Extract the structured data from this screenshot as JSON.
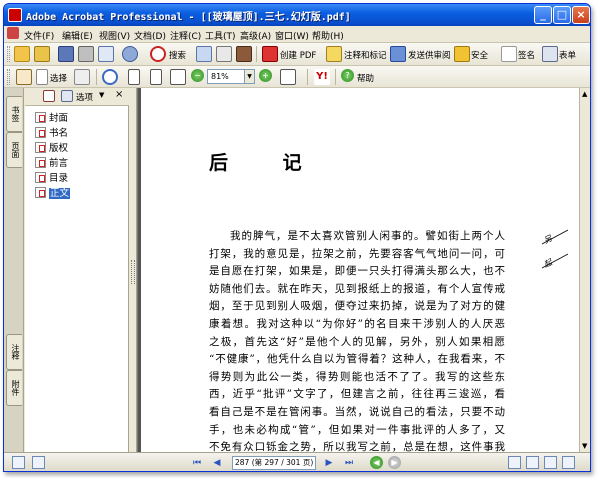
{
  "window": {
    "title": "Adobe Acrobat Professional - [[玻璃屋顶].三七.幻灯版.pdf]",
    "controls": {
      "minimize": "_",
      "maximize": "□",
      "close": "×"
    }
  },
  "menubar": {
    "items": [
      "文件(F)",
      "编辑(E)",
      "视图(V)",
      "文档(D)",
      "注释(C)",
      "工具(T)",
      "高级(A)",
      "窗口(W)",
      "帮助(H)"
    ]
  },
  "toolbar1": {
    "search_label": "搜索",
    "create_pdf_label": "创建 PDF",
    "comment_label": "注释和标记",
    "send_review_label": "发送供审阅",
    "secure_label": "安全",
    "sign_label": "签名",
    "forms_label": "表单"
  },
  "toolbar2": {
    "select_label": "选择",
    "zoom_value": "81%",
    "help_label": "帮助"
  },
  "nav_panel": {
    "options_label": "选项",
    "bookmarks": [
      {
        "label": "封面",
        "selected": false
      },
      {
        "label": "书名",
        "selected": false
      },
      {
        "label": "版权",
        "selected": false
      },
      {
        "label": "前言",
        "selected": false
      },
      {
        "label": "目录",
        "selected": false
      },
      {
        "label": "正文",
        "selected": true
      }
    ]
  },
  "left_tabs": {
    "top": [
      "书签",
      "页面"
    ],
    "bottom": [
      "注释",
      "附件"
    ]
  },
  "document": {
    "heading": "后  记",
    "lines": [
      "我的脾气，是不太喜欢管别人闲事的。譬如街上两个人",
      "打架，我的意见是，拉架之前，先要容客气气地问一问，可",
      "是自愿在打架，如果是，即便一只头打得满头那么大，也不",
      "妨随他们去。就在昨天，见到报纸上的报道，有个人宣传戒",
      "烟，至于见到别人吸烟，便夺过来扔掉，说是为了对方的健",
      "康着想。我对这种以“为你好”的名目来干涉别人的人厌恶",
      "之极，首先这“好”是他个人的见解，另外，别人如果相愿",
      "“不健康”，他凭什么自以为管得着？这种人，在我看来，不",
      "得势则为此公一类，得势则能也活不了了。我写的这些东",
      "西，近乎“批评”文字了，但建言之前，往往再三逡巡，看",
      "看自己是不是在管闲事。当然，说说自己的看法，只要不动",
      "手，也未必构成“管”，但如果对一件事批评的人多了，又",
      "不免有众口铄金之势，所以我写之前，总是在想，这件事我"
    ],
    "margin_notes": [
      "另",
      "起"
    ]
  },
  "statusbar": {
    "page_display": "287 (第 297 / 301 页)",
    "first": "⏮",
    "prev": "◀",
    "next": "▶",
    "last": "⏭",
    "back": "◀",
    "forward": "▶"
  }
}
